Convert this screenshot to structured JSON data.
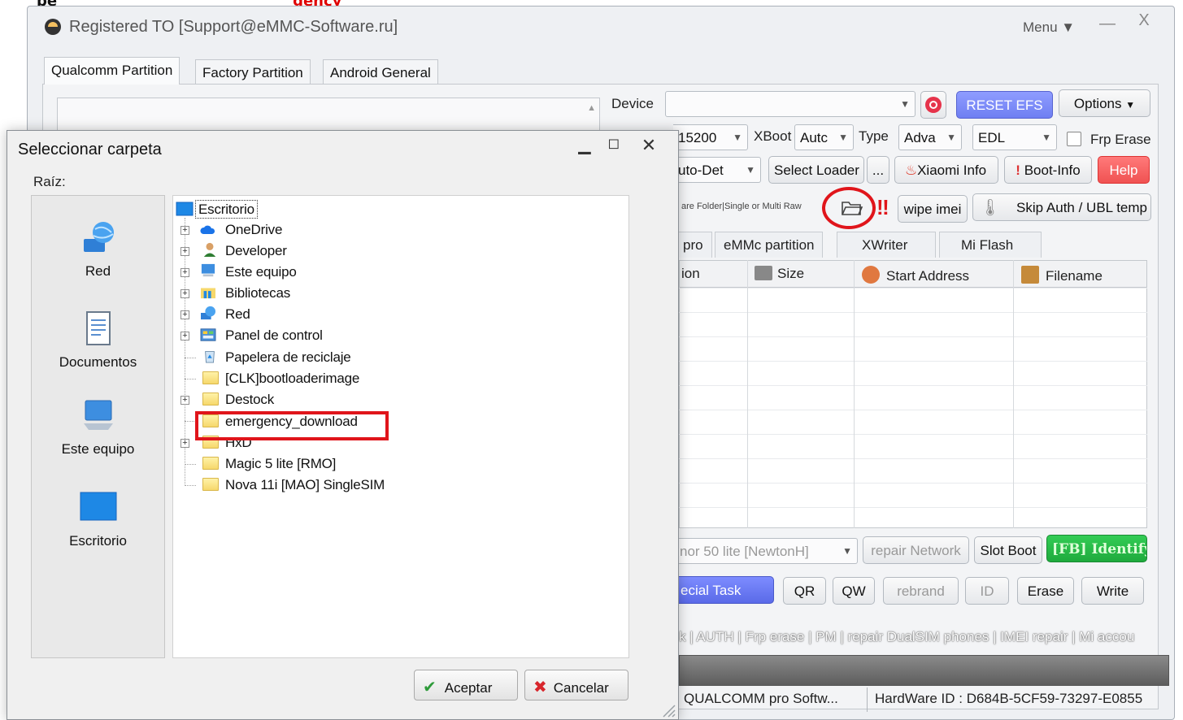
{
  "top_clip": {
    "text_black": "pe",
    "text_red": "gency_"
  },
  "app": {
    "title": "Registered TO [Support@eMMC-Software.ru]",
    "menu_label": "Menu ▼",
    "minimize": "—",
    "close": "X",
    "tabs": [
      {
        "label": "Qualcomm Partition",
        "active": true
      },
      {
        "label": "Factory Partition",
        "active": false
      },
      {
        "label": "Android General",
        "active": false
      }
    ],
    "device_label": "Device",
    "device_value": "",
    "reset_efs": "RESET EFS",
    "options": "Options",
    "row2": {
      "port": "15200",
      "xboot_label": "XBoot",
      "xboot_value": "Autc",
      "type_label": "Type",
      "type_value": "Adva",
      "mode": "EDL",
      "frp_erase": "Frp Erase"
    },
    "row3": {
      "autodet": "uto-Det",
      "select_loader": "Select Loader",
      "dots": "...",
      "xiaomi_info": "Xiaomi Info",
      "boot_info": "Boot-Info",
      "help": "Help"
    },
    "row4": {
      "firmware_hint": "are Folder|Single or Multi Raw",
      "wipe_imei": "wipe imei",
      "skip_auth": "Skip Auth / UBL temp"
    },
    "subtabs": [
      "pro",
      "eMMc partition",
      "XWriter",
      "Mi Flash"
    ],
    "grid_headers": [
      "ion",
      "Size",
      "Start Address",
      "Filename"
    ],
    "row5": {
      "model": "nor 50 lite [NewtonH]",
      "repair_network": "repair Network",
      "slot_boot": "Slot Boot",
      "identify": "[FB] Identify"
    },
    "row6": {
      "special_task": "ecial Task",
      "qr": "QR",
      "qw": "QW",
      "rebrand": "rebrand",
      "id": "ID",
      "erase": "Erase",
      "write": "Write"
    },
    "scroll_text": "k | AUTH | Frp erase | PM | repair DualSIM phones | IMEI repair | Mi accou",
    "status_left": "QUALCOMM pro Softw...",
    "status_right": "HardWare ID : D684B-5CF59-73297-E0855"
  },
  "dialog": {
    "title": "Seleccionar carpeta",
    "root_label": "Raíz:",
    "places": [
      {
        "label": "Red",
        "icon": "network-globe-icon"
      },
      {
        "label": "Documentos",
        "icon": "documents-icon"
      },
      {
        "label": "Este equipo",
        "icon": "computer-icon"
      },
      {
        "label": "Escritorio",
        "icon": "desktop-icon"
      }
    ],
    "tree_root": "Escritorio",
    "tree": [
      {
        "label": "OneDrive",
        "expandable": true,
        "icon": "cloud-icon"
      },
      {
        "label": "Developer",
        "expandable": true,
        "icon": "user-icon"
      },
      {
        "label": "Este equipo",
        "expandable": true,
        "icon": "computer-icon"
      },
      {
        "label": "Bibliotecas",
        "expandable": true,
        "icon": "library-icon"
      },
      {
        "label": "Red",
        "expandable": true,
        "icon": "network-icon"
      },
      {
        "label": "Panel de control",
        "expandable": true,
        "icon": "control-panel-icon"
      },
      {
        "label": "Papelera de reciclaje",
        "expandable": false,
        "icon": "recycle-bin-icon"
      },
      {
        "label": "[CLK]bootloaderimage",
        "expandable": false,
        "icon": "folder-icon"
      },
      {
        "label": "Destock",
        "expandable": true,
        "icon": "folder-icon"
      },
      {
        "label": "emergency_download",
        "expandable": false,
        "icon": "folder-icon"
      },
      {
        "label": "HxD",
        "expandable": true,
        "icon": "folder-icon"
      },
      {
        "label": "Magic 5 lite [RMO]",
        "expandable": false,
        "icon": "folder-icon"
      },
      {
        "label": "Nova 11i [MAO] SingleSIM",
        "expandable": false,
        "icon": "folder-icon"
      }
    ],
    "accept": "Aceptar",
    "cancel": "Cancelar"
  },
  "colors": {
    "highlight_red": "#e0151b",
    "reset_blue": "#6f7ff2",
    "help_red": "#f05252",
    "identify_green": "#1faa3d"
  }
}
